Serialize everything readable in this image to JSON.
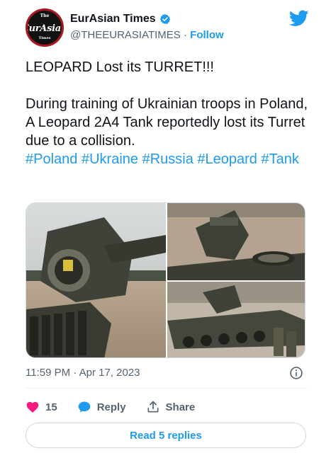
{
  "account": {
    "name": "EurAsian Times",
    "handle": "@THEEURASIATIMES",
    "separator": "·",
    "follow_label": "Follow",
    "avatar": {
      "top": "The",
      "main": "EurAsian",
      "sub": "Times"
    }
  },
  "tweet": {
    "headline": "LEOPARD Lost its TURRET!!!",
    "body": "During training of Ukrainian troops in Poland, A Leopard 2A4 Tank reportedly lost its Turret due to a collision.",
    "hashtags": [
      "#Poland",
      "#Ukraine",
      "#Russia",
      "#Leopard",
      "#Tank"
    ]
  },
  "meta": {
    "time": "11:59 PM",
    "separator": "·",
    "date": "Apr 17, 2023"
  },
  "actions": {
    "likes": "15",
    "reply_label": "Reply",
    "share_label": "Share"
  },
  "read_replies_label": "Read 5 replies",
  "colors": {
    "accent": "#1d9bf0",
    "like": "#f91880",
    "text": "#0f1419",
    "muted": "#536471"
  },
  "icons": [
    "verified-badge-icon",
    "twitter-bird-icon",
    "info-icon",
    "heart-icon",
    "reply-bubble-icon",
    "share-icon"
  ]
}
